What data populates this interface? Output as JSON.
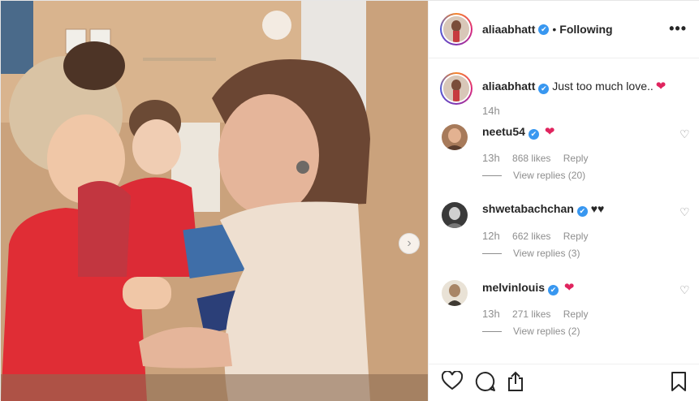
{
  "post": {
    "author": "aliaabhatt",
    "following_label": "Following",
    "separator": "•",
    "more_label": "•••",
    "caption": {
      "username": "aliaabhatt",
      "text": "Just too much love..",
      "emoji": "❤",
      "time": "14h"
    },
    "comments": [
      {
        "username": "neetu54",
        "text": "❤",
        "time": "13h",
        "likes": "868 likes",
        "reply_label": "Reply",
        "view_replies": "View replies (20)"
      },
      {
        "username": "shwetabachchan",
        "text": "♥♥",
        "time": "12h",
        "likes": "662 likes",
        "reply_label": "Reply",
        "view_replies": "View replies (3)"
      },
      {
        "username": "melvinlouis",
        "text": "❤",
        "time": "13h",
        "likes": "271 likes",
        "reply_label": "Reply",
        "view_replies": "View replies (2)"
      }
    ],
    "verified_mark": "✔",
    "comment_like_icon": "♡",
    "next_arrow": "›"
  },
  "icons": {
    "like": "heart-icon",
    "comment": "comment-icon",
    "share": "share-icon",
    "save": "bookmark-icon"
  },
  "colors": {
    "verified_blue": "#3897f0",
    "heart_red": "#e0245e",
    "muted_text": "#8e8e8e",
    "border": "#efefef"
  }
}
